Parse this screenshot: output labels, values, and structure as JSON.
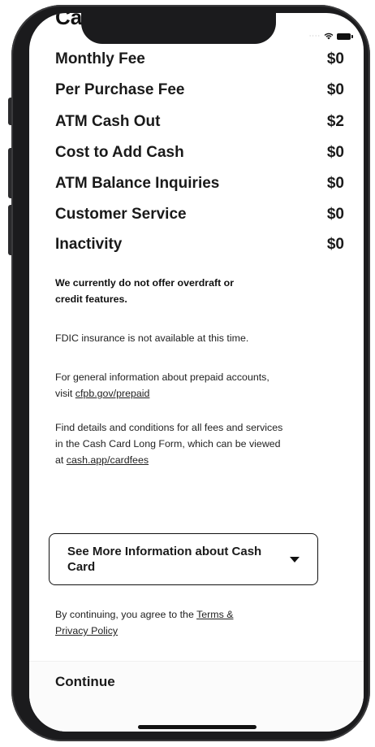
{
  "header": {
    "cut_title": "Cas"
  },
  "fees": [
    {
      "label": "Monthly Fee",
      "value": "$0"
    },
    {
      "label": "Per Purchase Fee",
      "value": "$0"
    },
    {
      "label": "ATM Cash Out",
      "value": "$2"
    },
    {
      "label": "Cost to Add Cash",
      "value": "$0"
    },
    {
      "label": "ATM Balance Inquiries",
      "value": "$0"
    },
    {
      "label": "Customer Service",
      "value": "$0"
    },
    {
      "label": "Inactivity",
      "value": "$0"
    }
  ],
  "notes": {
    "overdraft_line1": "We currently do not offer overdraft or",
    "overdraft_line2": "credit features.",
    "fdic": "FDIC insurance is not available at this time.",
    "prepaid_line1": "For general information about prepaid accounts,",
    "prepaid_visit": "visit ",
    "prepaid_link": "cfpb.gov/prepaid",
    "details_line1": "Find details and conditions for all fees and services",
    "details_line2": "in the Cash Card Long Form, which can be viewed",
    "details_at": "at ",
    "details_link": "cash.app/cardfees"
  },
  "more_info": {
    "label": "See More Information about Cash Card"
  },
  "terms": {
    "prefix": "By continuing, you agree to the ",
    "link_part1": "Terms &",
    "link_part2": "Privacy Policy"
  },
  "continue_label": "Continue",
  "status_bar": {
    "signal_icon": "signal-dots-icon",
    "wifi_icon": "wifi-icon",
    "battery_icon": "battery-icon"
  }
}
